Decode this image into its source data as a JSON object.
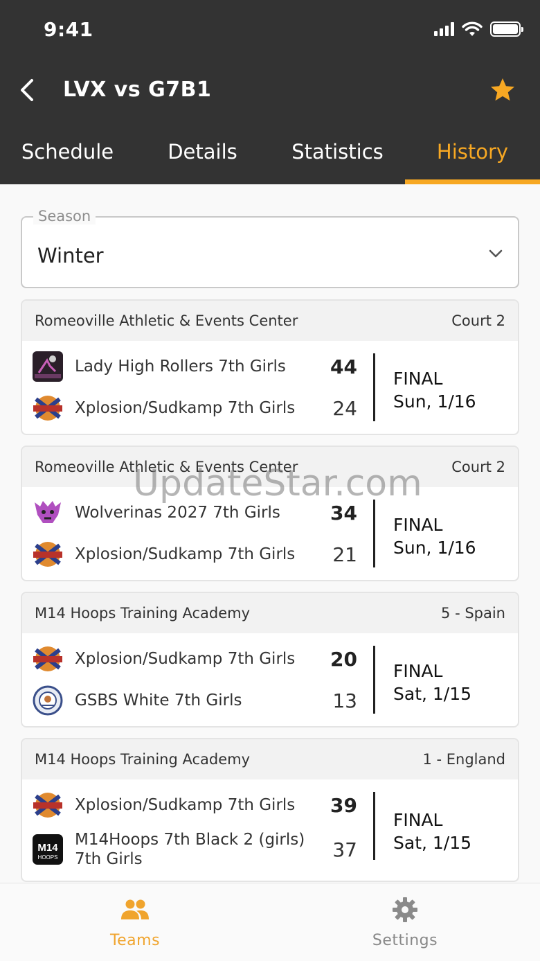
{
  "status_bar": {
    "time": "9:41"
  },
  "nav": {
    "title": "LVX vs G7B1"
  },
  "tabs": [
    {
      "label": "Schedule"
    },
    {
      "label": "Details"
    },
    {
      "label": "Statistics"
    },
    {
      "label": "History",
      "active": true
    }
  ],
  "season": {
    "legend": "Season",
    "value": "Winter"
  },
  "games": [
    {
      "venue": "Romeoville Athletic & Events Center",
      "court": "Court 2",
      "team1": {
        "name": "Lady High Rollers 7th Girls",
        "score": "44",
        "logo": "high-rollers-logo"
      },
      "team2": {
        "name": "Xplosion/Sudkamp 7th Girls",
        "score": "24",
        "logo": "xplosion-logo"
      },
      "status": "FINAL",
      "date": "Sun, 1/16"
    },
    {
      "venue": "Romeoville Athletic & Events Center",
      "court": "Court 2",
      "team1": {
        "name": "Wolverinas 2027 7th Girls",
        "score": "34",
        "logo": "wolverinas-logo"
      },
      "team2": {
        "name": "Xplosion/Sudkamp 7th Girls",
        "score": "21",
        "logo": "xplosion-logo"
      },
      "status": "FINAL",
      "date": "Sun, 1/16"
    },
    {
      "venue": "M14 Hoops Training Academy",
      "court": "5 - Spain",
      "team1": {
        "name": "Xplosion/Sudkamp 7th Girls",
        "score": "20",
        "logo": "xplosion-logo"
      },
      "team2": {
        "name": "GSBS White 7th Girls",
        "score": "13",
        "logo": "gsbs-logo"
      },
      "status": "FINAL",
      "date": "Sat, 1/15"
    },
    {
      "venue": "M14 Hoops Training Academy",
      "court": "1 - England",
      "team1": {
        "name": "Xplosion/Sudkamp 7th Girls",
        "score": "39",
        "logo": "xplosion-logo"
      },
      "team2": {
        "name": "M14Hoops 7th Black 2 (girls) 7th Girls",
        "score": "37",
        "logo": "m14-hoops-logo"
      },
      "status": "FINAL",
      "date": "Sat, 1/15"
    }
  ],
  "tabbar": [
    {
      "label": "Teams",
      "icon": "people-icon",
      "active": true
    },
    {
      "label": "Settings",
      "icon": "gear-icon"
    }
  ],
  "watermark": "UpdateStar.com",
  "colors": {
    "header": "#333333",
    "accent": "#f7a823"
  }
}
